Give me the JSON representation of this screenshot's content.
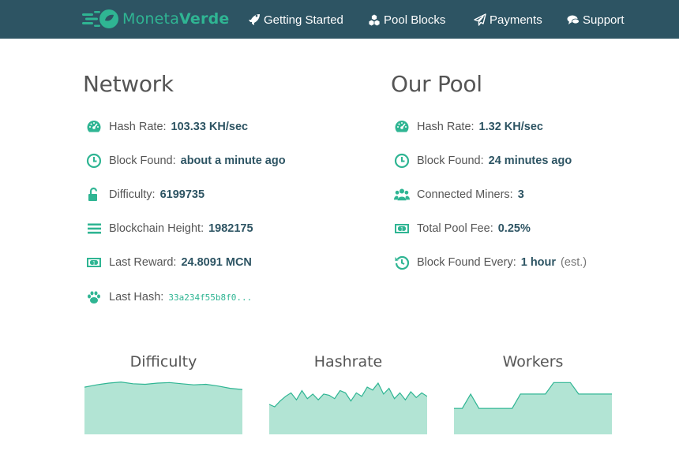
{
  "brand": {
    "name_light": "Moneta",
    "name_bold": "Verde"
  },
  "nav": [
    {
      "label": "Getting Started",
      "icon": "rocket-icon"
    },
    {
      "label": "Pool Blocks",
      "icon": "cubes-icon"
    },
    {
      "label": "Payments",
      "icon": "paper-plane-icon"
    },
    {
      "label": "Support",
      "icon": "comments-icon"
    }
  ],
  "network": {
    "title": "Network",
    "stats": [
      {
        "label": "Hash Rate:",
        "value": "103.33 KH/sec",
        "icon": "tachometer-icon"
      },
      {
        "label": "Block Found:",
        "value": "about a minute ago",
        "icon": "clock-icon"
      },
      {
        "label": "Difficulty:",
        "value": "6199735",
        "icon": "unlock-icon"
      },
      {
        "label": "Blockchain Height:",
        "value": "1982175",
        "icon": "bars-icon"
      },
      {
        "label": "Last Reward:",
        "value": "24.8091 MCN",
        "icon": "money-icon"
      },
      {
        "label": "Last Hash:",
        "value": "33a234f55b8f0...",
        "icon": "paw-icon"
      }
    ]
  },
  "pool": {
    "title": "Our Pool",
    "stats": [
      {
        "label": "Hash Rate:",
        "value": "1.32 KH/sec",
        "icon": "tachometer-icon"
      },
      {
        "label": "Block Found:",
        "value": "24 minutes ago",
        "icon": "clock-icon"
      },
      {
        "label": "Connected Miners:",
        "value": "3",
        "icon": "users-icon"
      },
      {
        "label": "Total Pool Fee:",
        "value": "0.25%",
        "icon": "money-icon"
      },
      {
        "label": "Block Found Every:",
        "value": "1 hour",
        "extra": "(est.)",
        "icon": "history-icon"
      }
    ]
  },
  "charts": [
    {
      "title": "Difficulty",
      "values": [
        0.82,
        0.86,
        0.89,
        0.91,
        0.88,
        0.87,
        0.89,
        0.9,
        0.88,
        0.86,
        0.87,
        0.84,
        0.8,
        0.78
      ]
    },
    {
      "title": "Hashrate",
      "values": [
        0.52,
        0.48,
        0.58,
        0.66,
        0.72,
        0.6,
        0.76,
        0.62,
        0.7,
        0.6,
        0.7,
        0.68,
        0.62,
        0.76,
        0.72,
        0.58,
        0.72,
        0.66,
        0.82,
        0.77,
        0.89,
        0.7,
        0.8,
        0.62,
        0.72,
        0.6,
        0.74,
        0.64,
        0.72,
        0.66
      ]
    },
    {
      "title": "Workers",
      "values": [
        0.45,
        0.45,
        0.7,
        0.45,
        0.45,
        0.45,
        0.45,
        0.45,
        0.7,
        0.7,
        0.7,
        0.7,
        0.9,
        0.9,
        0.9,
        0.7,
        0.7,
        0.7,
        0.7,
        0.7
      ]
    }
  ],
  "colors": {
    "accent": "#2fb593",
    "navbar": "#2d5463",
    "chart_fill": "#b2e4d4",
    "chart_line": "#2fb593"
  }
}
